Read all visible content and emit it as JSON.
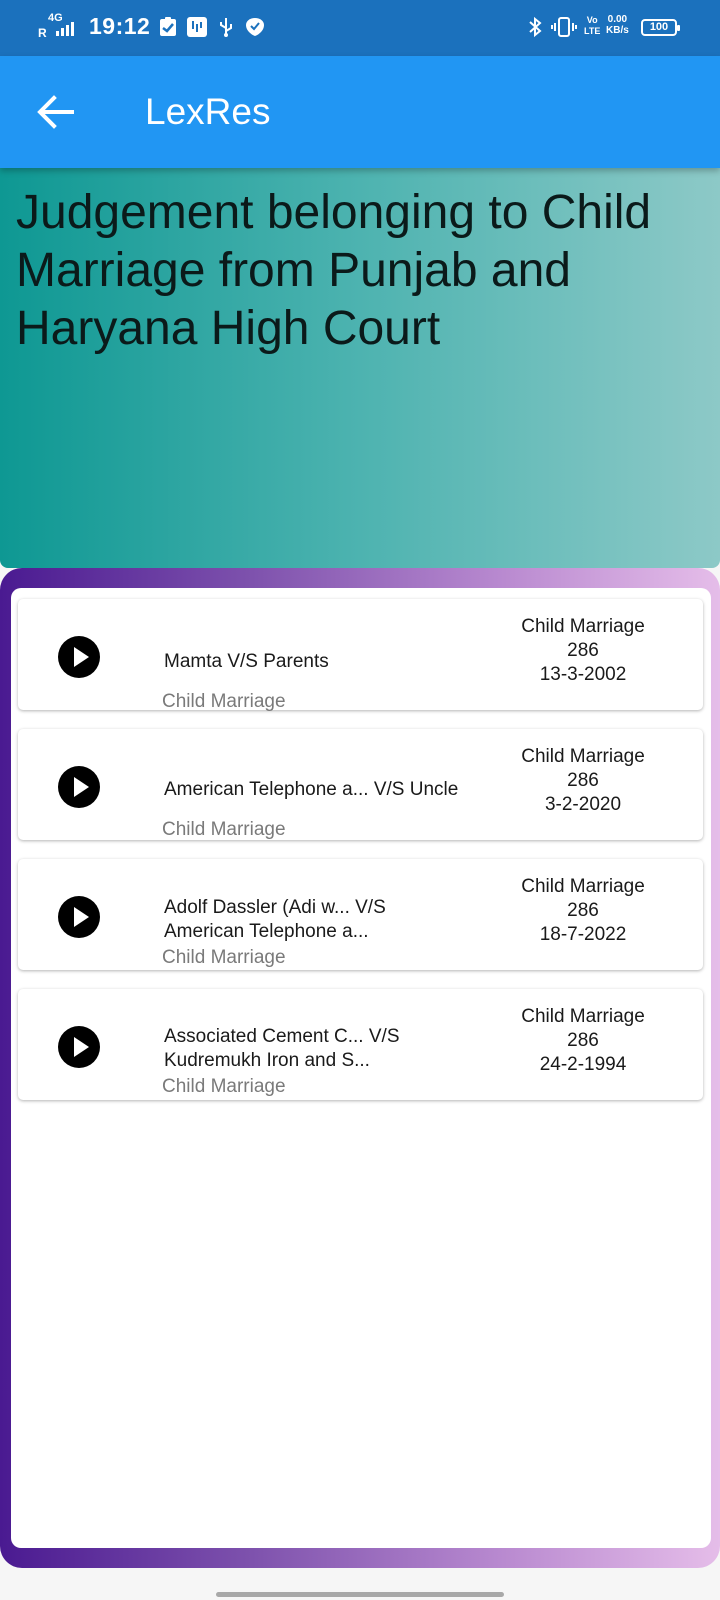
{
  "status_bar": {
    "network_type": "4G",
    "roaming": "R",
    "time": "19:12",
    "volte": "Vo",
    "lte": "LTE",
    "speed_value": "0.00",
    "speed_unit": "KB/s",
    "battery": "100"
  },
  "app_bar": {
    "title": "LexRes",
    "back_icon": "arrow-back-icon"
  },
  "banner": {
    "title": "Judgement belonging to Child Marriage from Punjab and Haryana High Court"
  },
  "cases": [
    {
      "title": "Mamta V/S Parents",
      "subtitle": "Child Marriage",
      "category": "Child Marriage",
      "section": "286",
      "date": "13-3-2002"
    },
    {
      "title": "American Telephone a... V/S Uncle",
      "subtitle": "Child Marriage",
      "category": "Child Marriage",
      "section": "286",
      "date": "3-2-2020"
    },
    {
      "title": "Adolf Dassler (Adi w... V/S\nAmerican Telephone a...",
      "subtitle": "Child Marriage",
      "category": "Child Marriage",
      "section": "286",
      "date": "18-7-2022"
    },
    {
      "title": " Associated Cement C... V/S\nKudremukh Iron and S...",
      "subtitle": "Child Marriage",
      "category": "Child Marriage",
      "section": "286",
      "date": "24-2-1994"
    }
  ],
  "colors": {
    "status_bar": "#1b71bd",
    "app_bar": "#2196f3",
    "banner_start": "#0e9893",
    "banner_end": "#8dc9c7",
    "frame_start": "#4a1a91",
    "frame_end": "#e5bde9"
  }
}
